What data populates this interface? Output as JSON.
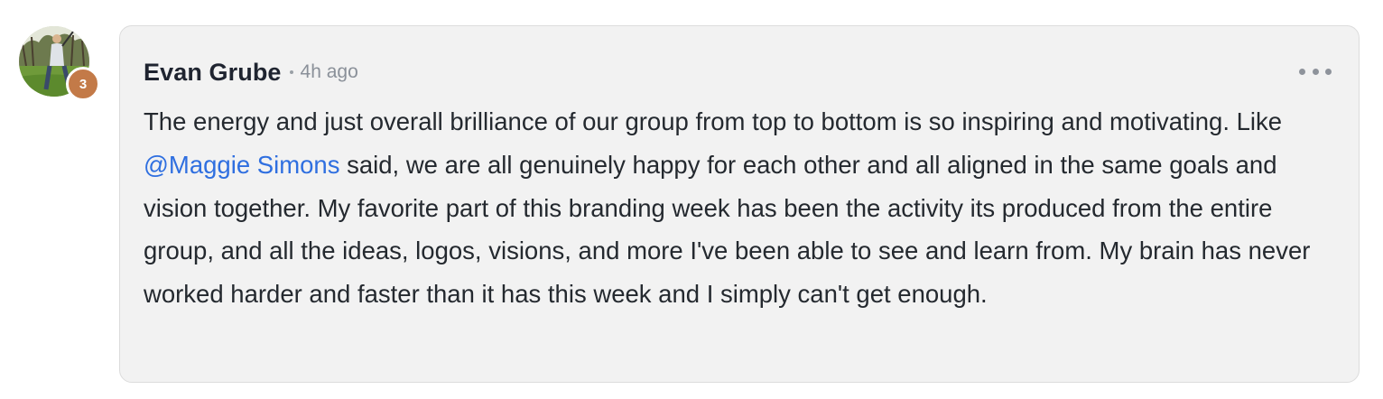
{
  "comment": {
    "author": "Evan Grube",
    "timestamp": "4h ago",
    "level_badge": "3",
    "avatar_icon": "avatar-photo-icon",
    "more_icon": "more-options-icon",
    "text_before_mention": "The energy and just overall brilliance of our group from top to bottom is so inspiring and motivating. Like ",
    "mention": "@Maggie Simons",
    "text_after_mention": " said, we are all genuinely happy for each other and all aligned in the same goals and vision together. My favorite part of this branding week has been the activity its produced from the entire group, and all the ideas, logos, visions, and more I've been able to see and learn from. My brain has never worked harder and faster than it has this week and I simply can't get enough."
  },
  "colors": {
    "bubble_background": "#f2f2f2",
    "mention": "#2f6fe0",
    "badge": "#c37a48",
    "text": "#24292f"
  }
}
